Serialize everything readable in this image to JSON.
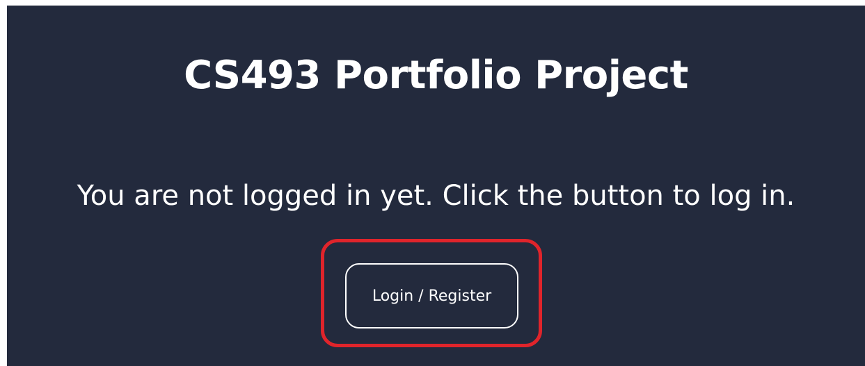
{
  "page": {
    "title": "CS493 Portfolio Project",
    "message": "You are not logged in yet. Click the button to log in.",
    "login_button_label": "Login / Register"
  },
  "colors": {
    "background": "#232a3d",
    "text": "#ffffff",
    "highlight": "#e0242b"
  }
}
